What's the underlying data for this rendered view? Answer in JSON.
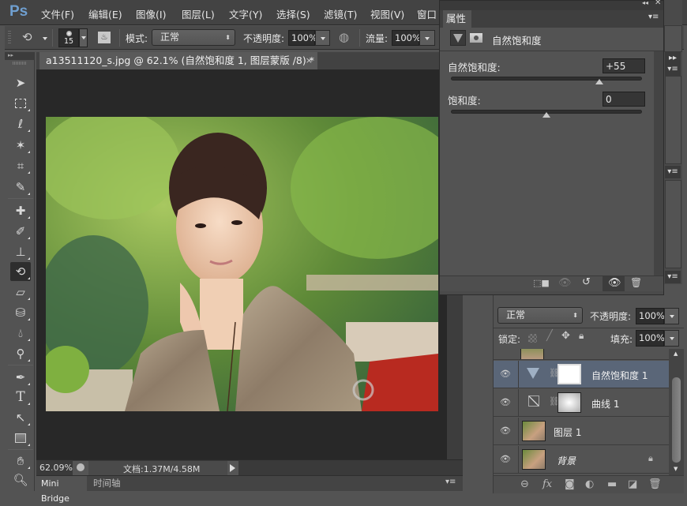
{
  "app": {
    "logo": "Ps"
  },
  "menu": [
    "文件(F)",
    "编辑(E)",
    "图像(I)",
    "图层(L)",
    "文字(Y)",
    "选择(S)",
    "滤镜(T)",
    "视图(V)",
    "窗口"
  ],
  "options": {
    "brush_size": "15",
    "mode_label": "模式:",
    "mode_value": "正常",
    "opacity_label": "不透明度:",
    "opacity_value": "100%",
    "flow_label": "流量:",
    "flow_value": "100%"
  },
  "document": {
    "tab_title": "a13511120_s.jpg @ 62.1% (自然饱和度 1, 图层蒙版 /8) *",
    "close": "×",
    "zoom": "62.09%",
    "doc_info": "文档:1.37M/4.58M"
  },
  "bottom_tabs": [
    "Mini Bridge",
    "时间轴"
  ],
  "tools": [
    "move",
    "marquee",
    "lasso",
    "magic-wand",
    "crop",
    "eyedropper",
    "healing",
    "brush",
    "stamp",
    "history-brush",
    "eraser",
    "paint-bucket",
    "blur",
    "dodge",
    "pen",
    "type",
    "path-select",
    "rectangle",
    "hand",
    "zoom"
  ],
  "properties": {
    "tab": "属性",
    "title": "自然饱和度",
    "vibrance_label": "自然饱和度:",
    "vibrance_value": "+55",
    "vibrance_fraction": 0.775,
    "saturation_label": "饱和度:",
    "saturation_value": "0",
    "saturation_fraction": 0.5
  },
  "layers_panel": {
    "blend_mode": "正常",
    "opacity_label": "不透明度:",
    "opacity_value": "100%",
    "lock_label": "锁定:",
    "fill_label": "填充:",
    "fill_value": "100%",
    "layers": [
      {
        "name": "自然饱和度 1",
        "type": "vibrance-adjustment",
        "selected": true,
        "visible": true
      },
      {
        "name": "曲线 1",
        "type": "curves-adjustment",
        "selected": false,
        "visible": true
      },
      {
        "name": "图层 1",
        "type": "pixel",
        "selected": false,
        "visible": true
      },
      {
        "name": "背景",
        "type": "background",
        "selected": false,
        "visible": true,
        "locked": true
      }
    ]
  }
}
